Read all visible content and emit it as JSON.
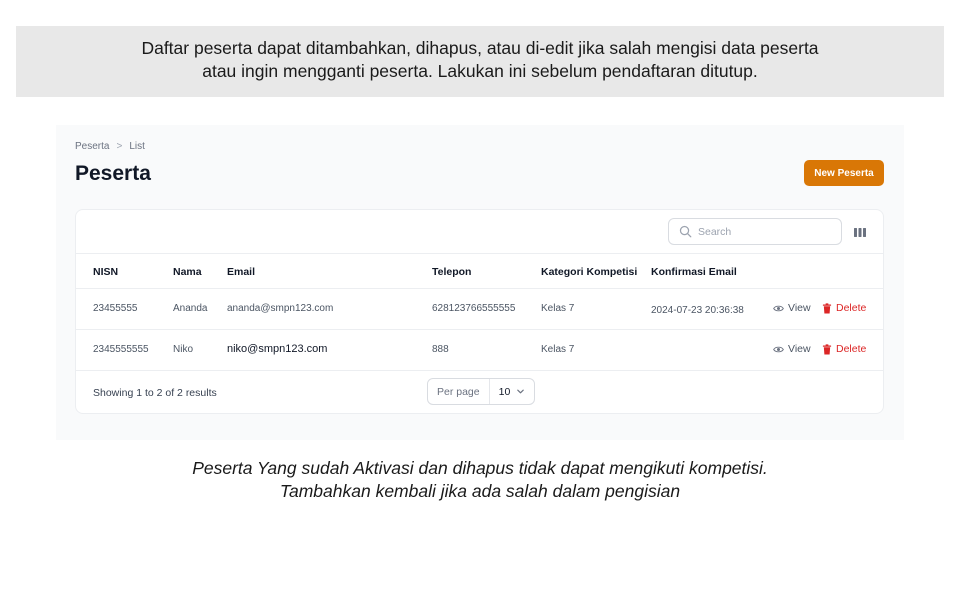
{
  "top_note": {
    "line1": "Daftar peserta dapat ditambahkan, dihapus, atau di-edit jika salah mengisi data peserta",
    "line2": "atau ingin mengganti peserta. Lakukan ini sebelum pendaftaran ditutup."
  },
  "breadcrumb": {
    "root": "Peserta",
    "separator": ">",
    "current": "List"
  },
  "page": {
    "title": "Peserta",
    "new_button": "New Peserta"
  },
  "colors": {
    "accent": "#d97706",
    "danger": "#dc2626"
  },
  "search": {
    "placeholder": "Search",
    "icon": "search-icon"
  },
  "toolbar": {
    "columns_icon": "columns-icon"
  },
  "table": {
    "headers": {
      "nisn": "NISN",
      "nama": "Nama",
      "email": "Email",
      "telepon": "Telepon",
      "kategori": "Kategori Kompetisi",
      "konfirmasi": "Konfirmasi Email"
    },
    "rows": [
      {
        "nisn": "23455555",
        "nama": "Ananda",
        "email": "ananda@smpn123.com",
        "telepon": "628123766555555",
        "kategori": "Kelas 7",
        "konfirmasi": "2024-07-23 20:36:38",
        "view": "View",
        "delete": "Delete"
      },
      {
        "nisn": "2345555555",
        "nama": "Niko",
        "email": "niko@smpn123.com",
        "telepon": "888",
        "kategori": "Kelas 7",
        "konfirmasi": "",
        "view": "View",
        "delete": "Delete"
      }
    ]
  },
  "footer": {
    "results": "Showing 1 to 2 of 2 results",
    "per_page_label": "Per page",
    "per_page_value": "10"
  },
  "bottom_note": {
    "line1": "Peserta Yang sudah Aktivasi dan dihapus tidak dapat mengikuti kompetisi.",
    "line2": "Tambahkan kembali jika ada salah dalam pengisian"
  }
}
